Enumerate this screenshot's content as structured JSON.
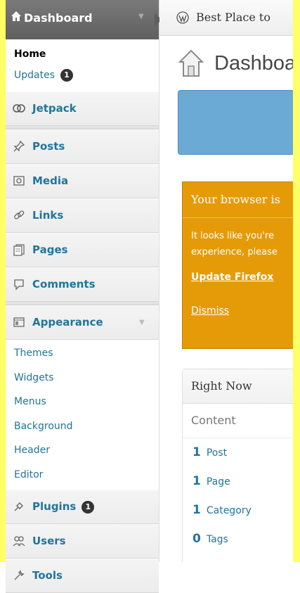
{
  "sidebar": {
    "dashboard_label": "Dashboard",
    "dashboard_sub": [
      {
        "label": "Home",
        "current": true
      },
      {
        "label": "Updates",
        "badge": "1"
      }
    ],
    "items": [
      {
        "label": "Jetpack",
        "icon": "jetpack-icon"
      },
      {
        "label": "Posts",
        "icon": "pushpin-icon"
      },
      {
        "label": "Media",
        "icon": "media-icon"
      },
      {
        "label": "Links",
        "icon": "link-icon"
      },
      {
        "label": "Pages",
        "icon": "pages-icon"
      },
      {
        "label": "Comments",
        "icon": "comment-icon"
      },
      {
        "label": "Appearance",
        "icon": "appearance-icon"
      }
    ],
    "appearance_sub": [
      "Themes",
      "Widgets",
      "Menus",
      "Background",
      "Header",
      "Editor"
    ],
    "plugins_label": "Plugins",
    "plugins_badge": "1",
    "users_label": "Users",
    "tools_label": "Tools"
  },
  "topbar": {
    "site_title": "Best Place to"
  },
  "page": {
    "title": "Dashboard"
  },
  "notice": {
    "header": "Your browser is",
    "line1": "It looks like you're",
    "line2": "experience, please",
    "update_link": "Update Firefox",
    "dismiss": "Dismiss"
  },
  "right_now": {
    "title": "Right Now",
    "subtitle": "Content",
    "rows": [
      {
        "n": "1",
        "label": "Post"
      },
      {
        "n": "1",
        "label": "Page"
      },
      {
        "n": "1",
        "label": "Category"
      },
      {
        "n": "0",
        "label": "Tags"
      }
    ]
  },
  "colors": {
    "link": "#21759b",
    "notice": "#e59b08",
    "blue_box": "#6aaad4"
  }
}
